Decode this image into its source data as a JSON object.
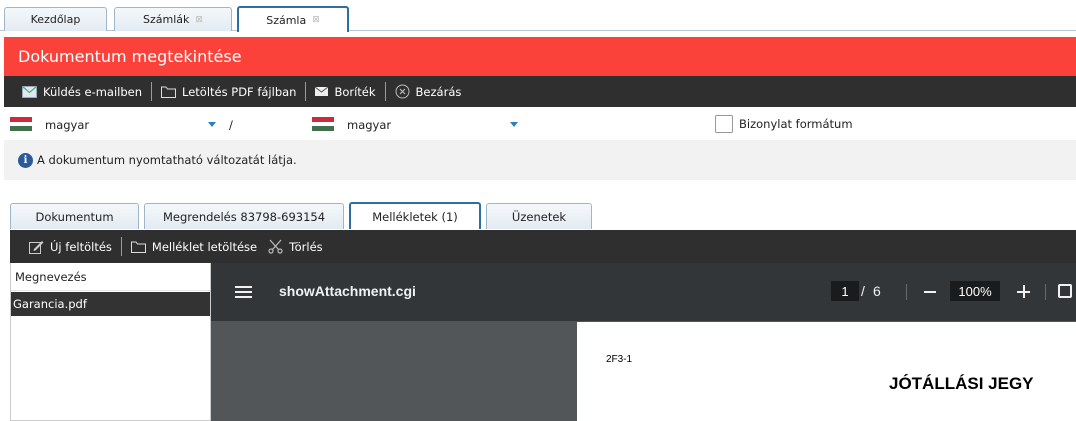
{
  "top_tabs": [
    {
      "label": "Kezdőlap",
      "closable": false
    },
    {
      "label": "Számlák",
      "closable": true
    },
    {
      "label": "Számla",
      "closable": true,
      "active": true
    }
  ],
  "close_glyph": "⊠",
  "header": {
    "title": "Dokumentum megtekintése",
    "color": "#fb423a"
  },
  "toolbar": {
    "send_email": "Küldés e-mailben",
    "download_pdf": "Letöltés PDF fájlban",
    "envelope": "Boríték",
    "close": "Bezárás"
  },
  "language": {
    "source": "magyar",
    "separator": "/",
    "target": "magyar",
    "document_format_label": "Bizonylat formátum",
    "document_format_checked": false
  },
  "info": {
    "icon": "i",
    "text": "A dokumentum nyomtatható változatát látja."
  },
  "sub_tabs": [
    {
      "label": "Dokumentum"
    },
    {
      "label": "Megrendelés 83798-693154"
    },
    {
      "label": "Mellékletek (1)",
      "active": true
    },
    {
      "label": "Üzenetek"
    }
  ],
  "attachment_toolbar": {
    "upload": "Új feltöltés",
    "download": "Melléklet letöltése",
    "delete": "Törlés"
  },
  "attachment_list": {
    "column_header": "Megnevezés",
    "rows": [
      "Garancia.pdf"
    ]
  },
  "pdf_viewer": {
    "title": "showAttachment.cgi",
    "current_page": "1",
    "page_separator": "/",
    "total_pages": "6",
    "zoom": "100%",
    "page_code": "2F3-1",
    "page_heading": "JÓTÁLLÁSI JEGY"
  }
}
